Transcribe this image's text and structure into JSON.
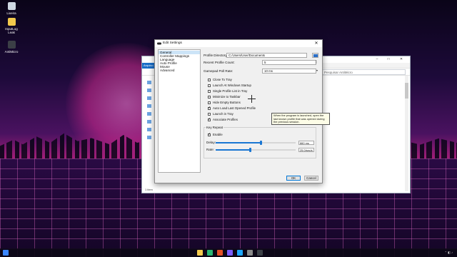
{
  "desktop": {
    "icons": [
      {
        "label": "Lixeira"
      },
      {
        "label": "InputLog Leak"
      },
      {
        "label": "AntiMicro"
      }
    ]
  },
  "background_window": {
    "ribbon_tab": "Arquivo",
    "search_placeholder": "Pesquisar AntiMicro",
    "status_text": "1 item"
  },
  "dialog": {
    "title": "Edit Settings",
    "close_glyph": "✕",
    "nav_items": [
      {
        "label": "General",
        "selected": true
      },
      {
        "label": "Controller Mappings",
        "selected": false
      },
      {
        "label": "Language",
        "selected": false
      },
      {
        "label": "Auto Profile",
        "selected": false
      },
      {
        "label": "Mouse",
        "selected": false
      },
      {
        "label": "Advanced",
        "selected": false
      }
    ],
    "profile_directory": {
      "label": "Profile Directory:",
      "value": "C:/Users/User/Documents"
    },
    "recent_profile_count": {
      "label": "Recent Profile Count:",
      "value": "5"
    },
    "gamepad_poll_rate": {
      "label": "Gamepad Poll Rate:",
      "value": "10 ms"
    },
    "checkboxes": [
      {
        "label": "Close To Tray",
        "checked": false
      },
      {
        "label": "Launch At Windows Startup",
        "checked": false
      },
      {
        "label": "Single Profile List in Tray",
        "checked": false
      },
      {
        "label": "Minimize to Taskbar",
        "checked": false
      },
      {
        "label": "Hide Empty Buttons",
        "checked": false
      },
      {
        "label": "Auto Load Last Opened Profile",
        "checked": true
      },
      {
        "label": "Launch in Tray",
        "checked": false
      },
      {
        "label": "Associate Profiles",
        "checked": true
      }
    ],
    "tooltip": "When the program is launched, open the last known profile that was opened during the previous session.",
    "key_repeat": {
      "legend": "Key Repeat",
      "enable_label": "Enable",
      "enable_checked": true,
      "delay_label": "Delay:",
      "delay_value": "660 ms",
      "delay_fraction": 0.56,
      "rate_label": "Rate:",
      "rate_value": "25.0/sec/s",
      "rate_fraction": 0.43
    },
    "ok_label": "OK",
    "cancel_label": "Cancel"
  },
  "colors": {
    "accent": "#1a76d2",
    "selection": "#cce4f7",
    "tooltip_bg": "#fdfde7"
  }
}
